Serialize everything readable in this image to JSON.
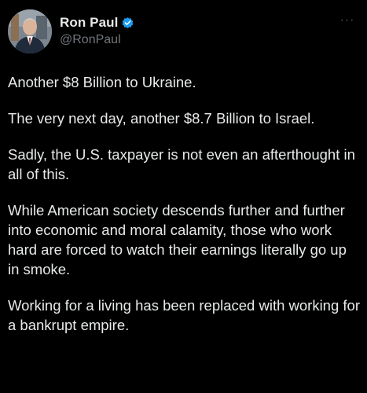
{
  "author": {
    "display_name": "Ron Paul",
    "handle": "@RonPaul",
    "verified": true,
    "verified_color": "#1d9bf0"
  },
  "menu": {
    "icon": "more-horizontal-icon",
    "glyph": "···"
  },
  "post": {
    "paragraphs": [
      "Another $8 Billion to Ukraine.",
      "The very next day, another $8.7 Billion to Israel.",
      "Sadly, the U.S. taxpayer is not even an afterthought in all of this.",
      "While American society descends further and further into economic and moral calamity, those who work hard are forced to watch their earnings literally go up in smoke.",
      "Working for a living has been replaced with working for a bankrupt empire."
    ]
  },
  "colors": {
    "background": "#000000",
    "text": "#e7e9ea",
    "secondary_text": "#71767b"
  }
}
